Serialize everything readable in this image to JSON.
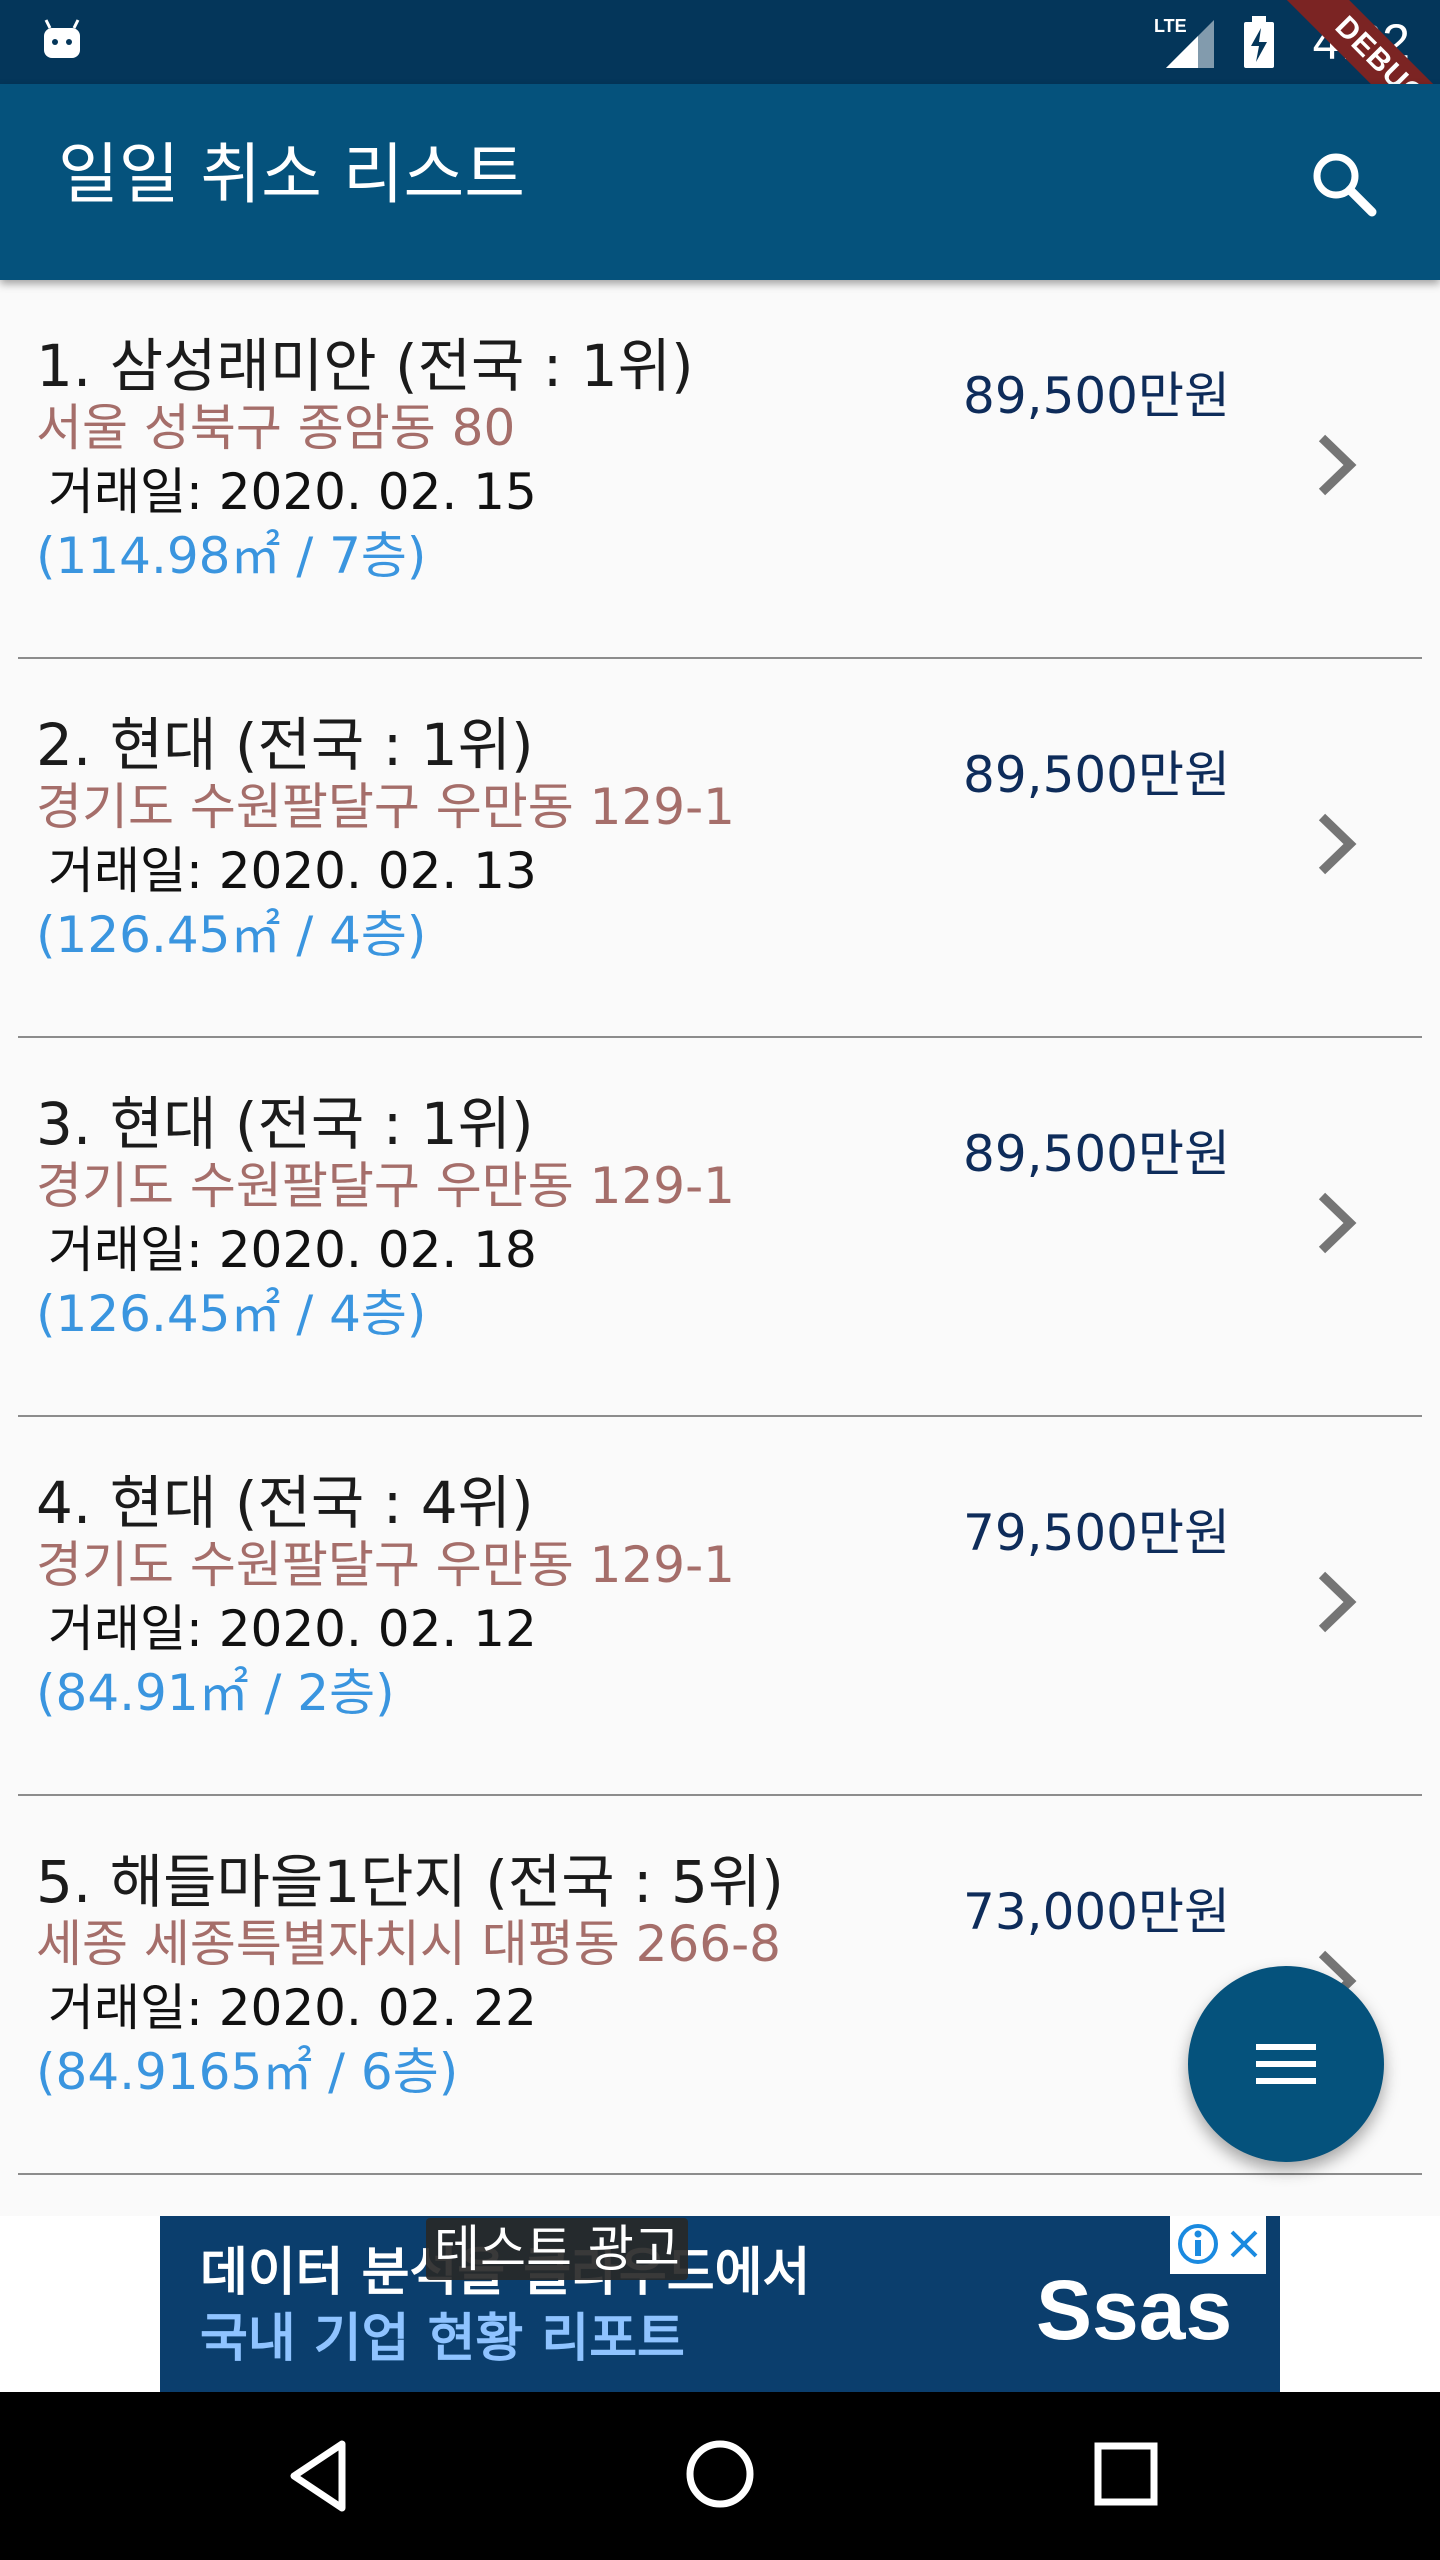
{
  "status": {
    "time": "4:32",
    "network": "LTE",
    "debug_label": "DEBUG"
  },
  "appbar": {
    "title": "일일 취소 리스트"
  },
  "items": [
    {
      "title": "1. 삼성래미안 (전국 : 1위)",
      "address": "서울 성북구 종암동 80",
      "date": " 거래일: 2020. 02. 15",
      "area": "(114.98㎡ / 7층)",
      "price": "89,500만원"
    },
    {
      "title": "2. 현대 (전국 : 1위)",
      "address": "경기도 수원팔달구 우만동 129-1",
      "date": " 거래일: 2020. 02. 13",
      "area": "(126.45㎡ / 4층)",
      "price": "89,500만원"
    },
    {
      "title": "3. 현대 (전국 : 1위)",
      "address": "경기도 수원팔달구 우만동 129-1",
      "date": " 거래일: 2020. 02. 18",
      "area": "(126.45㎡ / 4층)",
      "price": "89,500만원"
    },
    {
      "title": "4. 현대 (전국 : 4위)",
      "address": "경기도 수원팔달구 우만동 129-1",
      "date": " 거래일: 2020. 02. 12",
      "area": "(84.91㎡ / 2층)",
      "price": "79,500만원"
    },
    {
      "title": "5. 해들마을1단지 (전국 : 5위)",
      "address": "세종 세종특별자치시 대평동 266-8",
      "date": " 거래일: 2020. 02. 22",
      "area": "(84.9165㎡ / 6층)",
      "price": "73,000만원"
    }
  ],
  "ad": {
    "label": "테스트 광고",
    "line1": "데이터 분석을 클라우드에서",
    "line2": "국내 기업 현황 리포트",
    "logo": "Ssas"
  },
  "colors": {
    "appbar": "#05527c",
    "statusbar": "#04365a",
    "address": "#a56e6a",
    "area": "#3a95df",
    "price": "#0e2c5a"
  }
}
